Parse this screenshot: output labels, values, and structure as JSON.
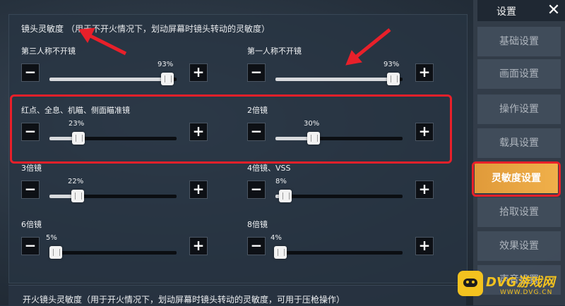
{
  "sidebar": {
    "title": "设置",
    "close_icon": "close-icon",
    "items": [
      {
        "label": "基础设置",
        "active": false
      },
      {
        "label": "画面设置",
        "active": false
      },
      {
        "label": "操作设置",
        "active": false
      },
      {
        "label": "载具设置",
        "active": false
      },
      {
        "label": "灵敏度设置",
        "active": true
      },
      {
        "label": "拾取设置",
        "active": false
      },
      {
        "label": "效果设置",
        "active": false
      },
      {
        "label": "声音设置",
        "active": false
      }
    ]
  },
  "section": {
    "title": "镜头灵敏度",
    "note": "（用于不开火情况下，划动屏幕时镜头转动的灵敏度）"
  },
  "settings": [
    {
      "label": "第三人称不开镜",
      "percent": 93,
      "value": 0.93
    },
    {
      "label": "第一人称不开镜",
      "percent": 93,
      "value": 0.93
    },
    {
      "label": "红点、全息、机瞄、侧面瞄准镜",
      "percent": 23,
      "value": 0.23
    },
    {
      "label": "2倍镜",
      "percent": 30,
      "value": 0.3
    },
    {
      "label": "3倍镜",
      "percent": 22,
      "value": 0.22
    },
    {
      "label": "4倍镜、VSS",
      "percent": 8,
      "value": 0.08
    },
    {
      "label": "6倍镜",
      "percent": 5,
      "value": 0.05
    },
    {
      "label": "8倍镜",
      "percent": 4,
      "value": 0.04
    }
  ],
  "settings_display": [
    "93%",
    "93%",
    "23%",
    "30%",
    "22%",
    "8%",
    "5%",
    "4%"
  ],
  "bottom": {
    "title": "开火镜头灵敏度（用于开火情况下，划动屏幕时镜头转动的灵敏度，可用于压枪操作）"
  },
  "watermark": {
    "brand": "DVG游戏网",
    "url": "WWW.DVG.CN"
  },
  "colors": {
    "accent": "#f0a640",
    "highlight": "#e8202a",
    "watermark": "#f3c21f"
  }
}
